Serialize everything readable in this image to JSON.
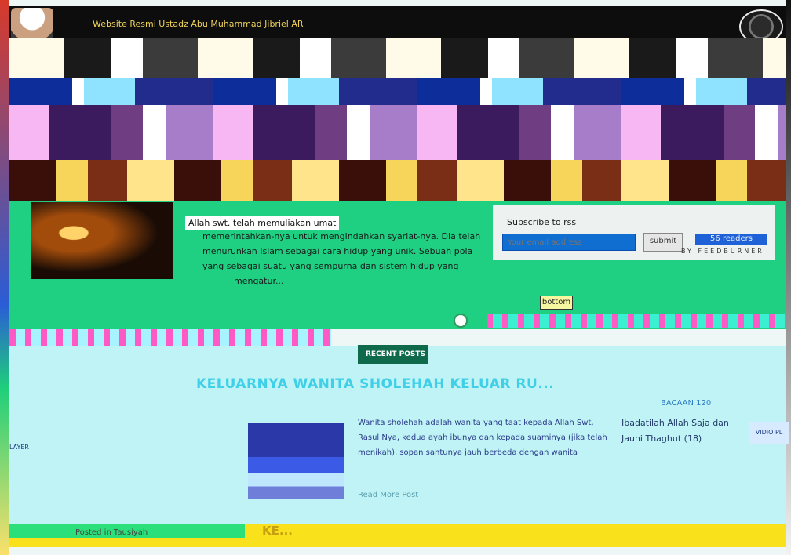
{
  "header": {
    "site_title": "Website Resmi Ustadz Abu Muhammad Jibriel AR"
  },
  "featured": {
    "lead": "Allah swt. telah memuliakan umat",
    "text": "memerintahkan-nya untuk mengindahkan syariat-nya. Dia telah menurunkan Islam sebagai cara hidup yang unik. Sebuah pola yang",
    "text2": "sebagai suatu yang sempurna dan sistem hidup yang",
    "more": "mengatur..."
  },
  "subscribe": {
    "label": "Subscribe to rss",
    "placeholder": "Your email address",
    "submit_label": "submit",
    "feed_badge": "56 readers",
    "by_feedburner": "BY FEEDBURNER",
    "bottom_button": "bottom"
  },
  "recent": {
    "label": "RECENT POSTS"
  },
  "post": {
    "title": "KELUARNYA WANITA SHOLEHAH KELUAR RU...",
    "excerpt": "Wanita sholehah adalah wanita yang taat kepada Allah Swt, Rasul Nya, kedua ayah ibunya dan kepada suaminya (jika telah menikah), sopan santunya jauh berbeda dengan wanita",
    "read_more": "Read More Post"
  },
  "categories": {
    "title": "BACAAN 120",
    "link": "Ibadatilah Allah Saja dan Jauhi Thaghut (18)"
  },
  "sidebar": {
    "head": "VIDIO PL"
  },
  "left": {
    "label": "LAYER"
  },
  "footer": {
    "title": "KE...",
    "small": "Posted in Tausiyah"
  }
}
